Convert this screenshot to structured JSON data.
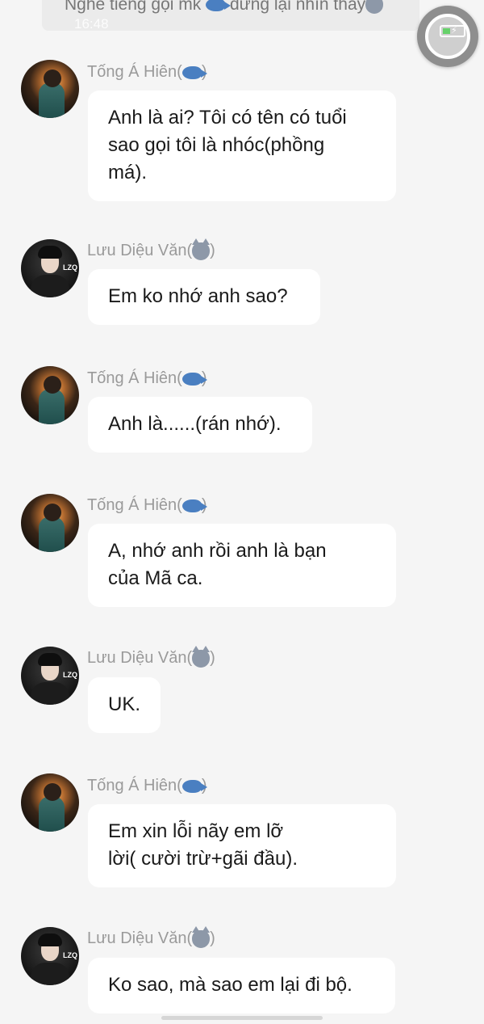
{
  "notification": {
    "text_before": "Nghe tiếng gọi mk",
    "text_mid": "dừng lại nhìn thấy",
    "time": "16:48"
  },
  "messages": [
    {
      "sender": "Tống Á Hiên",
      "avatar": "hien",
      "emoji": "whale",
      "lines": [
        "Anh là ai? Tôi có tên có tuổi",
        "sao gọi tôi là nhóc(phồng",
        "má)."
      ]
    },
    {
      "sender": "Lưu Diệu Văn",
      "avatar": "van",
      "emoji": "wolf",
      "lines": [
        "Em ko nhớ anh sao?"
      ]
    },
    {
      "sender": "Tống Á Hiên",
      "avatar": "hien",
      "emoji": "whale",
      "lines": [
        "Anh là......(rán nhớ)."
      ]
    },
    {
      "sender": "Tống Á Hiên",
      "avatar": "hien",
      "emoji": "whale",
      "lines": [
        "A, nhớ anh rồi anh là bạn",
        "của Mã ca."
      ]
    },
    {
      "sender": "Lưu Diệu Văn",
      "avatar": "van",
      "emoji": "wolf",
      "lines": [
        "UK."
      ]
    },
    {
      "sender": "Tống Á Hiên",
      "avatar": "hien",
      "emoji": "whale",
      "lines": [
        "Em xin lỗi nãy em lỡ",
        "lời( cười trừ+gãi đầu)."
      ]
    },
    {
      "sender": "Lưu Diệu Văn",
      "avatar": "van",
      "emoji": "wolf",
      "lines": [
        "Ko sao, mà sao em lại đi bộ."
      ]
    }
  ],
  "colors": {
    "background": "#f5f5f5",
    "bubble": "#ffffff",
    "name": "#9a9a9a"
  }
}
